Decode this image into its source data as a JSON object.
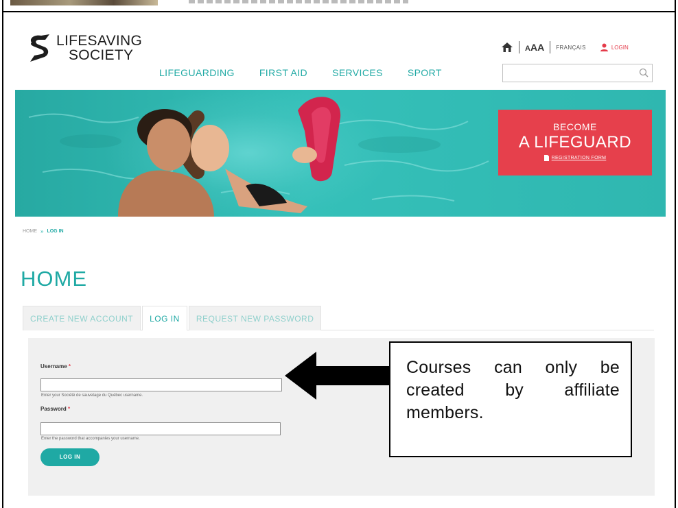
{
  "header": {
    "logo_line1": "LIFESAVING",
    "logo_line2": "SOCIETY",
    "nav": [
      "LIFEGUARDING",
      "FIRST AID",
      "SERVICES",
      "SPORT"
    ],
    "font_size_label_small": "A",
    "font_size_label": "AA",
    "language_link": "FRANÇAIS",
    "login_link": "LOGIN",
    "search_value": ""
  },
  "banner": {
    "cta_line1": "BECOME",
    "cta_line2": "A LIFEGUARD",
    "cta_form_link": "REGISTRATION FORM"
  },
  "breadcrumb": {
    "home": "HOME",
    "separator": "»",
    "current": "LOG IN"
  },
  "page": {
    "title": "HOME",
    "tabs": [
      "CREATE NEW ACCOUNT",
      "LOG IN",
      "REQUEST NEW PASSWORD"
    ],
    "active_tab": "LOG IN"
  },
  "form": {
    "username_label": "Username",
    "required_mark": "*",
    "username_value": "",
    "username_help": "Enter your Société de sauvetage du Québec username.",
    "password_label": "Password",
    "password_value": "",
    "password_help": "Enter the password that accompanies your username.",
    "submit_label": "LOG IN"
  },
  "annotation": {
    "text": "Courses can only be created by affiliate members."
  },
  "colors": {
    "teal": "#1fa9a4",
    "banner_teal": "#2fb7b0",
    "cta_red": "#e6404c",
    "login_red": "#e43b4a"
  },
  "icons": [
    "home-icon",
    "user-icon",
    "search-icon",
    "document-icon",
    "arrow-left-icon",
    "logo-mark-icon"
  ]
}
